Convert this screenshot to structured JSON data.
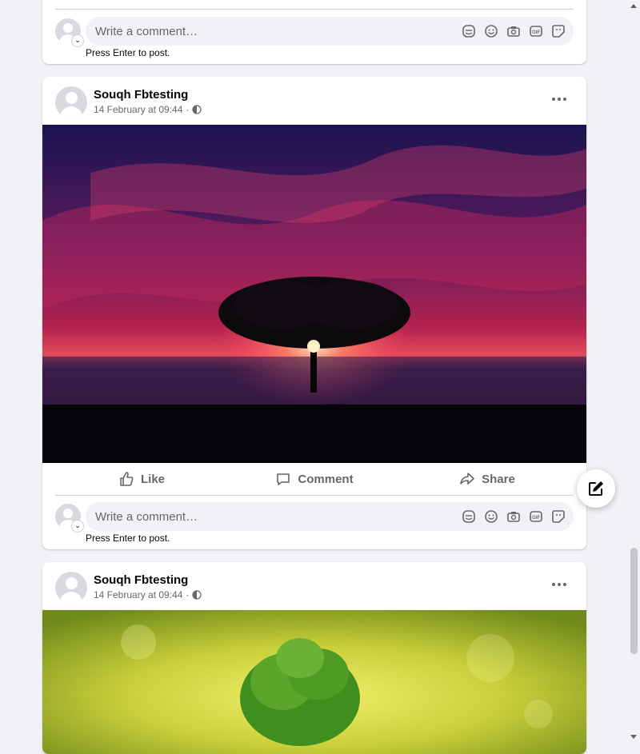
{
  "comment": {
    "placeholder": "Write a comment…",
    "hint": "Press Enter to post.",
    "icons": [
      "avatar-sticker-icon",
      "emoji-icon",
      "camera-icon",
      "gif-icon",
      "sticker-icon"
    ]
  },
  "posts": [
    {
      "author": "Souqh Fbtesting",
      "timestamp": "14 February at 09:44",
      "separator": "·",
      "privacy_icon": "globe-icon",
      "image": "sunset-tree-photo",
      "actions": {
        "like": "Like",
        "comment": "Comment",
        "share": "Share"
      }
    },
    {
      "author": "Souqh Fbtesting",
      "timestamp": "14 February at 09:44",
      "separator": "·",
      "privacy_icon": "globe-icon",
      "image": "green-tree-photo"
    }
  ],
  "fab": {
    "icon": "compose-icon"
  },
  "colors": {
    "page_bg": "#f0f2f5",
    "card_bg": "#ffffff",
    "secondary_text": "#65676b"
  }
}
